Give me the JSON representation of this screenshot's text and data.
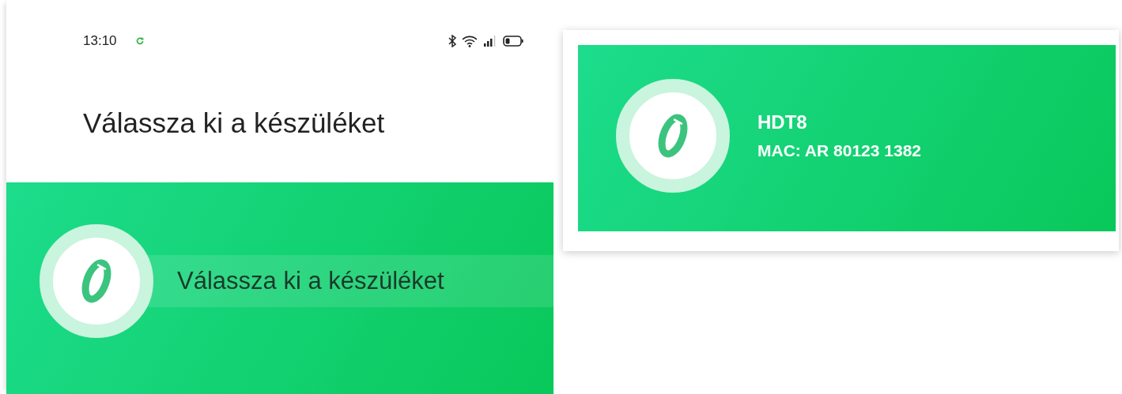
{
  "status_bar": {
    "time": "13:10"
  },
  "title": "Válassza ki a készüléket",
  "banner": {
    "text": "Válassza ki a készüléket"
  },
  "device": {
    "name": "HDT8",
    "mac": "MAC: AR 80123 1382"
  }
}
